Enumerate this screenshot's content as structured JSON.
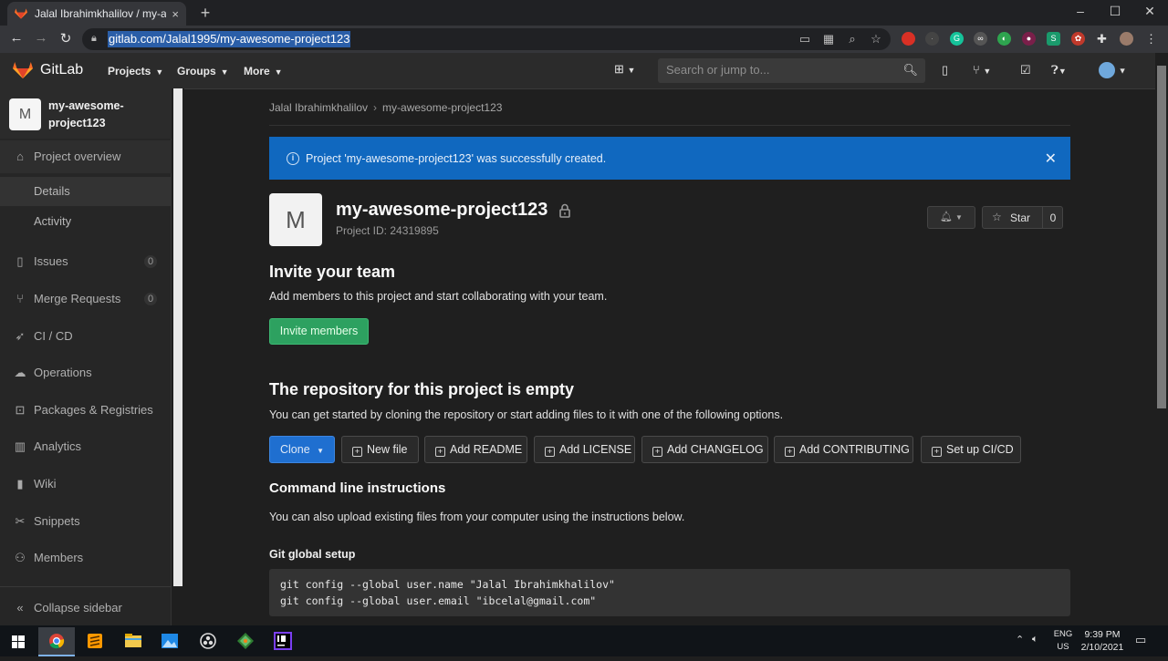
{
  "browser": {
    "tab_title": "Jalal Ibrahimkhalilov / my-aweso",
    "tab_close": "×",
    "new_tab": "+",
    "url": "gitlab.com/Jalal1995/my-awesome-project123"
  },
  "header": {
    "brand": "GitLab",
    "nav": [
      "Projects",
      "Groups",
      "More"
    ],
    "search_placeholder": "Search or jump to..."
  },
  "sidebar": {
    "project_avatar": "M",
    "project_name": "my-awesome-project123",
    "items": [
      {
        "label": "Project overview",
        "icon": "home-icon"
      },
      {
        "label": "Issues",
        "icon": "issues-icon",
        "count": "0"
      },
      {
        "label": "Merge Requests",
        "icon": "merge-request-icon",
        "count": "0"
      },
      {
        "label": "CI / CD",
        "icon": "rocket-icon"
      },
      {
        "label": "Operations",
        "icon": "cloud-gear-icon"
      },
      {
        "label": "Packages & Registries",
        "icon": "package-icon"
      },
      {
        "label": "Analytics",
        "icon": "chart-icon"
      },
      {
        "label": "Wiki",
        "icon": "book-icon"
      },
      {
        "label": "Snippets",
        "icon": "scissors-icon"
      },
      {
        "label": "Members",
        "icon": "users-icon"
      }
    ],
    "subitems": [
      "Details",
      "Activity"
    ],
    "collapse": "Collapse sidebar"
  },
  "breadcrumb": [
    "Jalal Ibrahimkhalilov",
    "my-awesome-project123"
  ],
  "alert": {
    "text": "Project 'my-awesome-project123' was successfully created."
  },
  "project": {
    "avatar": "M",
    "title": "my-awesome-project123",
    "id_text": "Project ID: 24319895",
    "star_label": "Star",
    "star_count": "0"
  },
  "invite": {
    "heading": "Invite your team",
    "text": "Add members to this project and start collaborating with your team.",
    "button": "Invite members"
  },
  "repo": {
    "heading": "The repository for this project is empty",
    "text": "You can get started by cloning the repository or start adding files to it with one of the following options.",
    "clone": "Clone",
    "buttons": [
      "New file",
      "Add README",
      "Add LICENSE",
      "Add CHANGELOG",
      "Add CONTRIBUTING",
      "Set up CI/CD"
    ]
  },
  "cli": {
    "heading": "Command line instructions",
    "text": "You can also upload existing files from your computer using the instructions below.",
    "subheading": "Git global setup",
    "code": [
      "git config --global user.name \"Jalal Ibrahimkhalilov\"",
      "git config --global user.email \"ibcelal@gmail.com\""
    ]
  },
  "taskbar": {
    "lang1": "ENG",
    "lang2": "US",
    "time": "9:39 PM",
    "date": "2/10/2021"
  },
  "colors": {
    "alert_bg": "#1068bf",
    "invite_bg": "#2da160",
    "clone_bg": "#1f6fd0",
    "gitlab_orange": "#fc6d26"
  }
}
